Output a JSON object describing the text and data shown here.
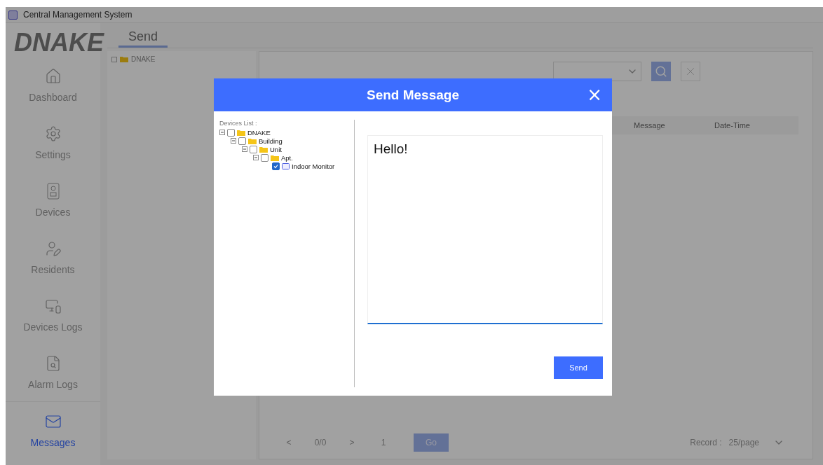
{
  "window": {
    "title": "Central Management System"
  },
  "logo": {
    "text": "DNAKE"
  },
  "sidebar": {
    "items": [
      {
        "label": "Dashboard",
        "selected": false
      },
      {
        "label": "Settings",
        "selected": false
      },
      {
        "label": "Devices",
        "selected": false
      },
      {
        "label": "Residents",
        "selected": false
      },
      {
        "label": "Devices Logs",
        "selected": false
      },
      {
        "label": "Alarm Logs",
        "selected": false
      },
      {
        "label": "Messages",
        "selected": true
      }
    ]
  },
  "tabs": [
    {
      "label": "Send",
      "selected": true
    }
  ],
  "background_tree": [
    {
      "label": "DNAKE"
    }
  ],
  "table": {
    "columns": [
      "Message",
      "Date-Time"
    ]
  },
  "pagination": {
    "prev": "<",
    "pages": "0/0",
    "next": ">",
    "page": "1",
    "go": "Go",
    "record_label": "Record :",
    "page_size": "25/page"
  },
  "dialog": {
    "title": "Send Message",
    "close": "×",
    "list_label": "Devices List :",
    "tree": [
      {
        "label": "DNAKE",
        "kind": "folder",
        "expanded": true,
        "checked": false,
        "children": [
          {
            "label": "Building",
            "kind": "folder",
            "expanded": true,
            "checked": false,
            "children": [
              {
                "label": "Unit",
                "kind": "folder",
                "expanded": true,
                "checked": false,
                "children": [
                  {
                    "label": "Apt.",
                    "kind": "folder",
                    "expanded": true,
                    "checked": false,
                    "children": [
                      {
                        "label": "Indoor Monitor",
                        "kind": "device",
                        "checked": true
                      }
                    ]
                  }
                ]
              }
            ]
          }
        ]
      }
    ],
    "message": "Hello!",
    "send": "Send"
  }
}
